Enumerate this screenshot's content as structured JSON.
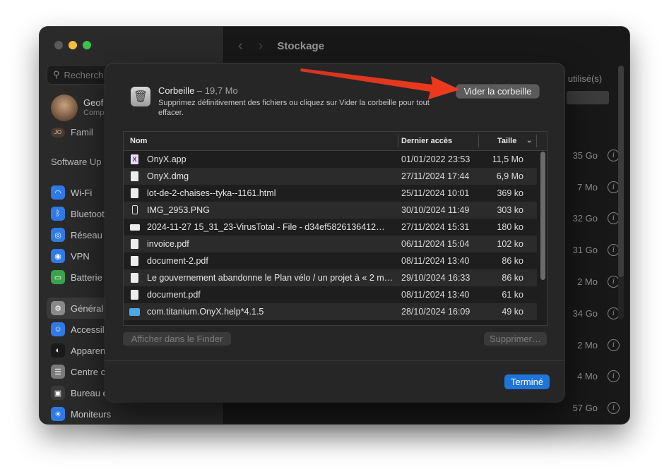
{
  "window": {
    "title": "Stockage"
  },
  "sidebar": {
    "search_placeholder": "Recherch",
    "profile": {
      "name": "Geof",
      "subtitle": "Comp"
    },
    "family_badge": "JO",
    "family_label": "Famil",
    "software_update": "Software Up",
    "items": [
      {
        "label": "Wi-Fi",
        "icon": "wifi-icon",
        "color": "#2f7ae5"
      },
      {
        "label": "Bluetoot",
        "icon": "bluetooth-icon",
        "color": "#2f7ae5"
      },
      {
        "label": "Réseau",
        "icon": "globe-icon",
        "color": "#2f7ae5"
      },
      {
        "label": "VPN",
        "icon": "vpn-icon",
        "color": "#2f7ae5"
      },
      {
        "label": "Batterie",
        "icon": "battery-icon",
        "color": "#3aa34a"
      },
      {
        "label": "Général",
        "icon": "gear-icon",
        "color": "#8a8a8a"
      },
      {
        "label": "Accessil",
        "icon": "accessibility-icon",
        "color": "#2f7ae5"
      },
      {
        "label": "Apparen",
        "icon": "appearance-icon",
        "color": "#1a1a1a"
      },
      {
        "label": "Centre c",
        "icon": "control-center-icon",
        "color": "#7a7a7a"
      },
      {
        "label": "Bureau e",
        "icon": "desktop-icon",
        "color": "#3a3a3a"
      },
      {
        "label": "Moniteurs",
        "icon": "display-icon",
        "color": "#2f7ae5"
      }
    ]
  },
  "main": {
    "used_label": "o utilisé(s)",
    "right_values": [
      "35 Go",
      "7 Mo",
      "32 Go",
      "31 Go",
      "2 Mo",
      "34 Go",
      "2 Mo",
      "4 Mo",
      "57 Go"
    ]
  },
  "sheet": {
    "title": "Corbeille",
    "size": " – 19,7 Mo",
    "description": "Supprimez définitivement des fichiers ou cliquez sur Vider la corbeille pour tout effacer.",
    "empty_button": "Vider la corbeille",
    "columns": {
      "name": "Nom",
      "date": "Dernier accès",
      "size": "Taille"
    },
    "files": [
      {
        "name": "OnyX.app",
        "date": "01/01/2022 23:53",
        "size": "11,5 Mo",
        "icon": "onyx-app-icon"
      },
      {
        "name": "OnyX.dmg",
        "date": "27/11/2024 17:44",
        "size": "6,9 Mo",
        "icon": "disk-image-icon"
      },
      {
        "name": "lot-de-2-chaises--tyka--1161.html",
        "date": "25/11/2024 10:01",
        "size": "369 ko",
        "icon": "document-icon"
      },
      {
        "name": "IMG_2953.PNG",
        "date": "30/10/2024 11:49",
        "size": "303 ko",
        "icon": "phone-image-icon"
      },
      {
        "name": "2024-11-27 15_31_23-VirusTotal - File - d34ef5826136412…",
        "date": "27/11/2024 15:31",
        "size": "180 ko",
        "icon": "screenshot-icon"
      },
      {
        "name": "invoice.pdf",
        "date": "06/11/2024 15:04",
        "size": "102 ko",
        "icon": "pdf-icon"
      },
      {
        "name": "document-2.pdf",
        "date": "08/11/2024 13:40",
        "size": "86 ko",
        "icon": "pdf-icon"
      },
      {
        "name": "Le gouvernement abandonne le Plan vélo / un projet à « 2 m…",
        "date": "29/10/2024 16:33",
        "size": "86 ko",
        "icon": "pdf-icon"
      },
      {
        "name": "document.pdf",
        "date": "08/11/2024 13:40",
        "size": "61 ko",
        "icon": "pdf-icon"
      },
      {
        "name": "com.titanium.OnyX.help*4.1.5",
        "date": "28/10/2024 16:09",
        "size": "49 ko",
        "icon": "folder-icon"
      }
    ],
    "finder_button": "Afficher dans le Finder",
    "delete_button": "Supprimer…",
    "done_button": "Terminé"
  },
  "annotation": {
    "arrow_color": "#e8351f"
  }
}
